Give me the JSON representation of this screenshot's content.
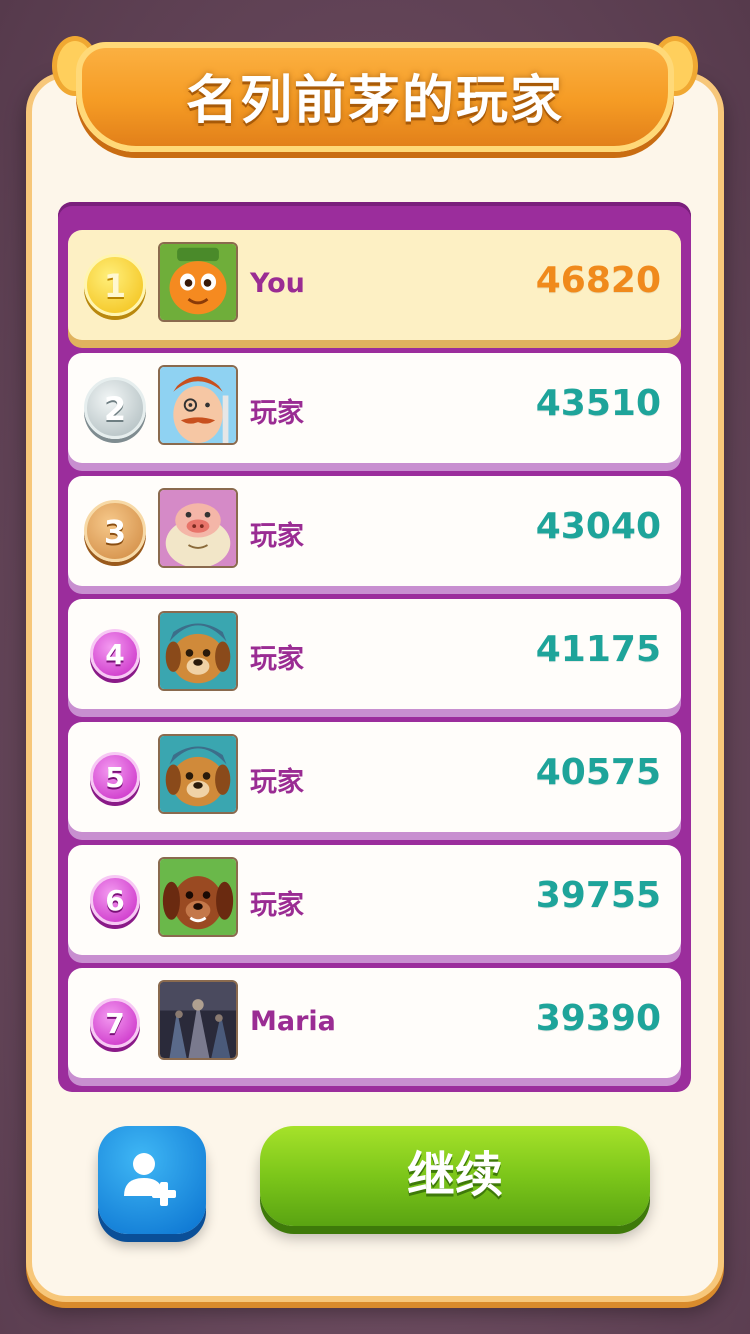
{
  "header": {
    "title": "名列前茅的玩家"
  },
  "leaderboard": {
    "rows": [
      {
        "rank": "1",
        "name": "You",
        "score": "46820",
        "avatar": "carrot-character"
      },
      {
        "rank": "2",
        "name": "玩家",
        "score": "43510",
        "avatar": "monocle-man"
      },
      {
        "rank": "3",
        "name": "玩家",
        "score": "43040",
        "avatar": "pig-character"
      },
      {
        "rank": "4",
        "name": "玩家",
        "score": "41175",
        "avatar": "pilot-dog"
      },
      {
        "rank": "5",
        "name": "玩家",
        "score": "40575",
        "avatar": "pilot-dog"
      },
      {
        "rank": "6",
        "name": "玩家",
        "score": "39755",
        "avatar": "brown-dog"
      },
      {
        "rank": "7",
        "name": "Maria",
        "score": "39390",
        "avatar": "photo"
      }
    ]
  },
  "actions": {
    "add_friend_icon": "add-friend-icon",
    "continue_label": "继续"
  },
  "colors": {
    "list_bg": "#9b2d9c",
    "score_teal": "#1ea49a",
    "my_score_orange": "#f08a1c",
    "continue_green": "#7cc61a",
    "add_friend_blue": "#1a8fe0"
  }
}
